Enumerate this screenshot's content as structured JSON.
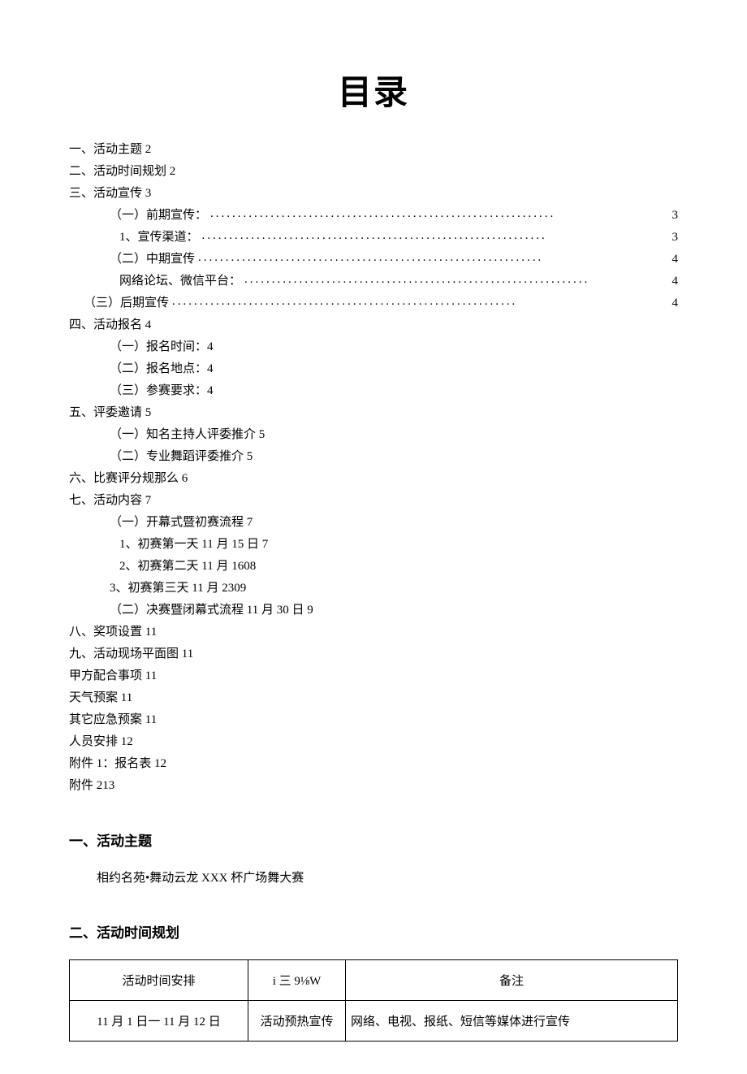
{
  "title": "目录",
  "toc": {
    "simple_top": [
      "一、活动主题 2",
      "二、活动时间规划 2",
      "三、活动宣传 3"
    ],
    "dotted_group": [
      {
        "indent": "indent-1",
        "label": "（一）前期宣传：",
        "page": "3"
      },
      {
        "indent": "indent-2",
        "label": "1、宣传渠道：",
        "page": "3"
      },
      {
        "indent": "indent-1",
        "label": "（二）中期宣传",
        "page": "4"
      },
      {
        "indent": "indent-2",
        "label": "网络论坛、微信平台：",
        "page": "4"
      },
      {
        "indent": "indent-3",
        "label": "（三）后期宣传",
        "page": "4"
      }
    ],
    "simple_mid": [
      {
        "cls": "",
        "text": "四、活动报名 4"
      },
      {
        "cls": "indent-1",
        "text": "（一）报名时间：4"
      },
      {
        "cls": "indent-1",
        "text": "（二）报名地点：4"
      },
      {
        "cls": "indent-1",
        "text": "（三）参赛要求：4"
      },
      {
        "cls": "",
        "text": "五、评委邀请 5"
      },
      {
        "cls": "indent-1",
        "text": "（一）知名主持人评委推介 5"
      },
      {
        "cls": "indent-1",
        "text": "（二）专业舞蹈评委推介 5"
      },
      {
        "cls": "",
        "text": "六、比赛评分规那么 6"
      },
      {
        "cls": "",
        "text": "七、活动内容 7"
      },
      {
        "cls": "indent-1",
        "text": "（一）开幕式暨初赛流程 7"
      },
      {
        "cls": "indent-2",
        "text": "1、初赛第一天 11 月 15 日 7"
      },
      {
        "cls": "indent-2",
        "text": "2、初赛第二天 11 月 1608"
      },
      {
        "cls": "indent-1",
        "text": "3、初赛第三天 11 月 2309"
      },
      {
        "cls": "indent-1",
        "text": "（二）决赛暨闭幕式流程 11 月 30 日 9"
      },
      {
        "cls": "",
        "text": "八、奖项设置 11"
      },
      {
        "cls": "",
        "text": "九、活动现场平面图 11"
      },
      {
        "cls": "",
        "text": "甲方配合事项 11"
      },
      {
        "cls": "",
        "text": "天气预案 11"
      },
      {
        "cls": "",
        "text": "其它应急预案 11"
      },
      {
        "cls": "",
        "text": "人员安排 12"
      },
      {
        "cls": "",
        "text": "附件 1：报名表 12"
      },
      {
        "cls": "",
        "text": "附件 213"
      }
    ]
  },
  "section1": {
    "heading": "一、活动主题",
    "text": "相约名苑•舞动云龙 XXX 杯广场舞大赛"
  },
  "section2": {
    "heading": "二、活动时间规划",
    "table": {
      "header": {
        "col1": "活动时间安排",
        "col2": "i 三 9⅛W",
        "col3": "备注"
      },
      "row1": {
        "col1": "11 月 1 日一 11 月 12 日",
        "col2": "活动预热宣传",
        "col3": "网络、电视、报纸、短信等媒体进行宣传"
      }
    }
  }
}
